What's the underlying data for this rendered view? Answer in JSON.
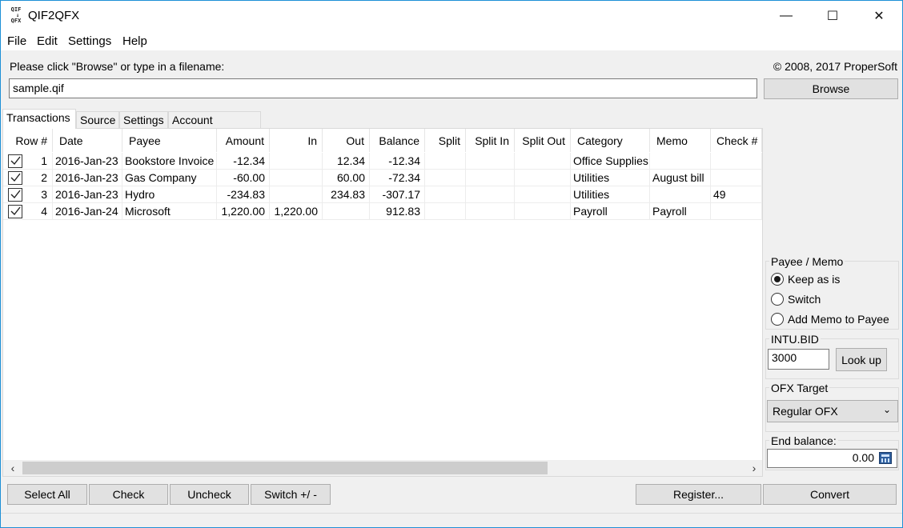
{
  "window": {
    "title": "QIF2QFX",
    "icon_text": "QIF QFX",
    "controls": {
      "minimize": "—",
      "maximize": "☐",
      "close": "✕"
    }
  },
  "menu": {
    "file": "File",
    "edit": "Edit",
    "settings": "Settings",
    "help": "Help"
  },
  "file_prompt": "Please click \"Browse\" or type in a filename:",
  "copyright": "© 2008, 2017 ProperSoft",
  "filename": "sample.qif",
  "browse_label": "Browse",
  "tabs": [
    "Transactions",
    "Source",
    "Settings",
    "Account Mapping"
  ],
  "table": {
    "columns": [
      "Row #",
      "Date",
      "Payee",
      "Amount",
      "In",
      "Out",
      "Balance",
      "Split",
      "Split In",
      "Split Out",
      "Category",
      "Memo",
      "Check #"
    ],
    "rows": [
      {
        "checked": true,
        "row": "1",
        "date": "2016-Jan-23",
        "payee": "Bookstore Invoice",
        "amount": "-12.34",
        "in": "",
        "out": "12.34",
        "balance": "-12.34",
        "split": "",
        "split_in": "",
        "split_out": "",
        "category": "Office Supplies",
        "memo": "",
        "check": ""
      },
      {
        "checked": true,
        "row": "2",
        "date": "2016-Jan-23",
        "payee": "Gas Company",
        "amount": "-60.00",
        "in": "",
        "out": "60.00",
        "balance": "-72.34",
        "split": "",
        "split_in": "",
        "split_out": "",
        "category": "Utilities",
        "memo": "August bill",
        "check": ""
      },
      {
        "checked": true,
        "row": "3",
        "date": "2016-Jan-23",
        "payee": "Hydro",
        "amount": "-234.83",
        "in": "",
        "out": "234.83",
        "balance": "-307.17",
        "split": "",
        "split_in": "",
        "split_out": "",
        "category": "Utilities",
        "memo": "",
        "check": "49"
      },
      {
        "checked": true,
        "row": "4",
        "date": "2016-Jan-24",
        "payee": "Microsoft",
        "amount": "1,220.00",
        "in": "1,220.00",
        "out": "",
        "balance": "912.83",
        "split": "",
        "split_in": "",
        "split_out": "",
        "category": "Payroll",
        "memo": "Payroll",
        "check": ""
      }
    ]
  },
  "payee_memo": {
    "label": "Payee / Memo",
    "options": [
      "Keep as is",
      "Switch",
      "Add Memo to Payee"
    ],
    "selected": "Keep as is"
  },
  "intu_bid": {
    "label": "INTU.BID",
    "value": "3000",
    "lookup_label": "Look up"
  },
  "ofx_target": {
    "label": "OFX Target",
    "value": "Regular OFX"
  },
  "end_balance": {
    "label": "End balance:",
    "value": "0.00"
  },
  "buttons": {
    "select_all": "Select All",
    "check": "Check",
    "uncheck": "Uncheck",
    "switch": "Switch +/ -",
    "register": "Register...",
    "convert": "Convert"
  }
}
